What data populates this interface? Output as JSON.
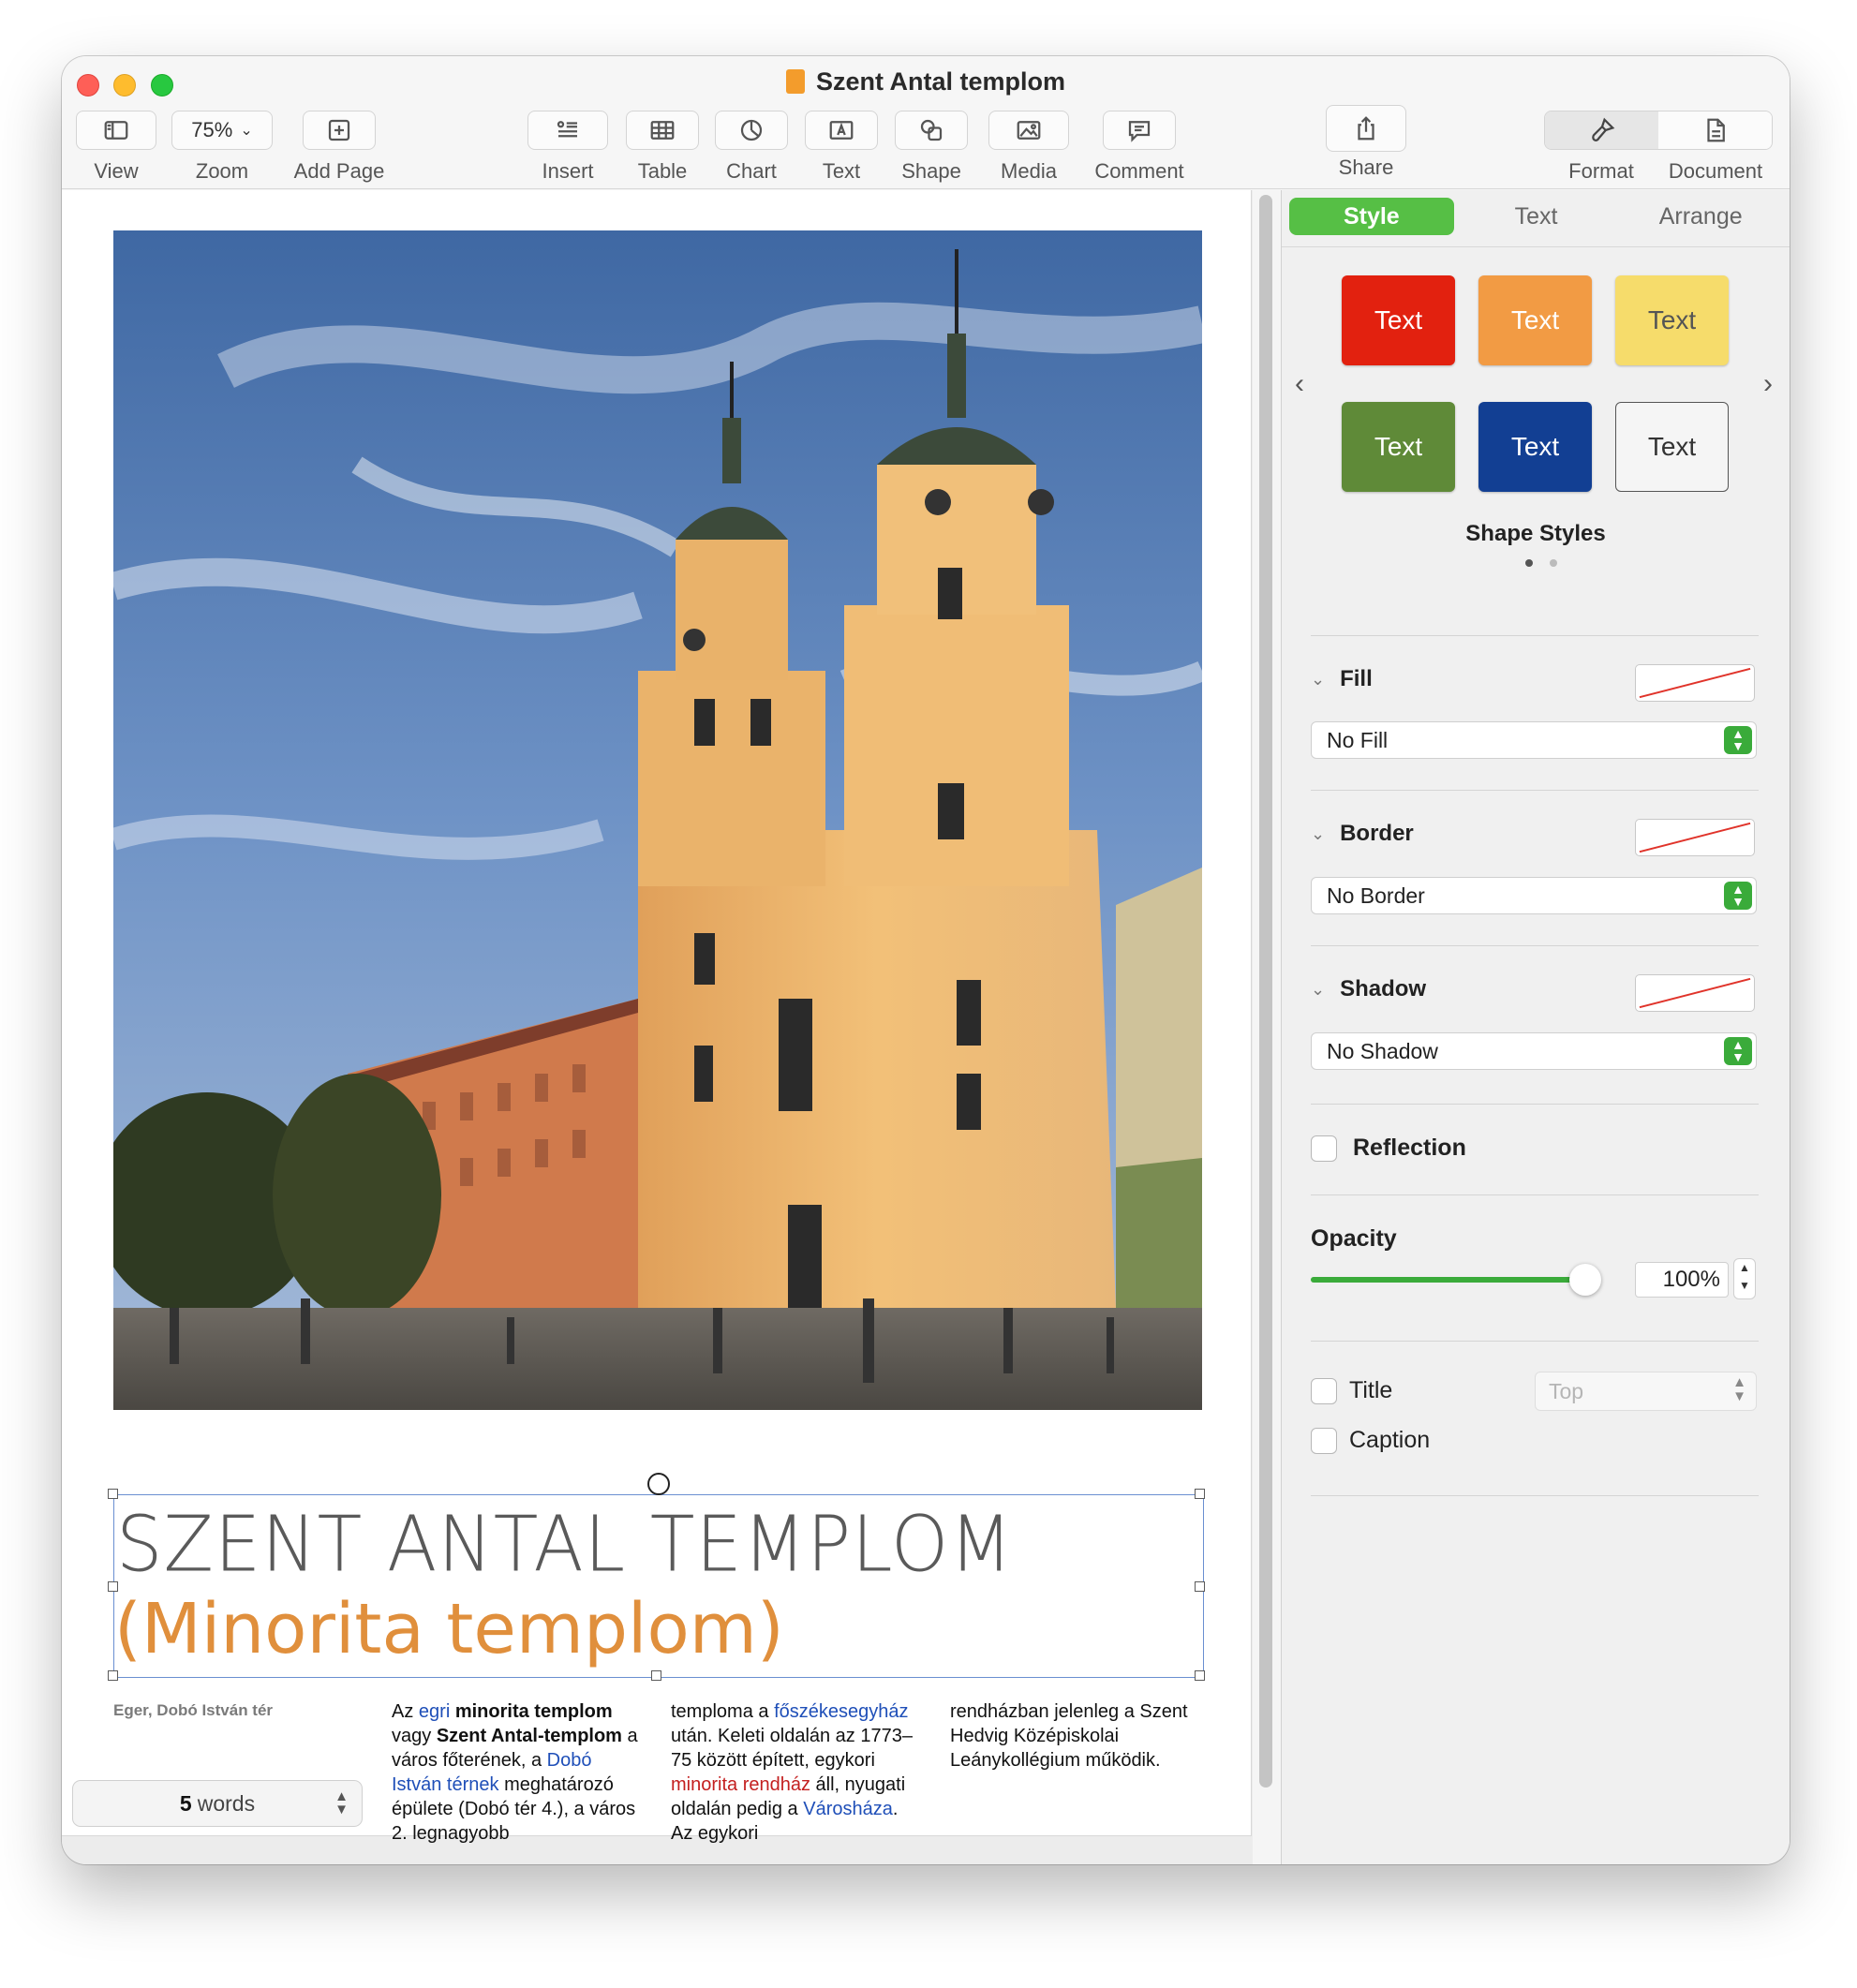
{
  "window": {
    "title": "Szent Antal templom"
  },
  "toolbar": {
    "view_label": "View",
    "zoom_value": "75%",
    "zoom_label": "Zoom",
    "add_page_label": "Add Page",
    "insert_label": "Insert",
    "table_label": "Table",
    "chart_label": "Chart",
    "text_label": "Text",
    "shape_label": "Shape",
    "media_label": "Media",
    "comment_label": "Comment",
    "share_label": "Share",
    "format_label": "Format",
    "document_label": "Document"
  },
  "document": {
    "title_line1": "SZENT ANTAL TEMPLOM",
    "title_line2": "(Minorita templom)",
    "image_caption": "Eger, Dobó István tér",
    "col1": {
      "t1": "Az ",
      "t2": "egri",
      "t3": " ",
      "t4": "minorita templom",
      "t5": " vagy ",
      "t6": "Szent Antal-templom",
      "t7": " a város főterének, a ",
      "t8": "Dobó István térnek",
      "t9": " meghatározó épülete (Dobó tér 4.), a város 2. legnagyobb"
    },
    "col2": {
      "t1": "temploma a ",
      "t2": "főszékesegyház",
      "t3": " után. Keleti oldalán az 1773–75 között épített, egykori ",
      "t4": "minorita rendház",
      "t5": " áll, nyugati oldalán pedig a ",
      "t6": "Városháza",
      "t7": ". Az egykori"
    },
    "col3": {
      "t1": "rendházban jelenleg a Szent Hedvig Középiskolai Leánykollégium működik."
    },
    "word_count": "5",
    "word_count_label": "words"
  },
  "inspector": {
    "tabs": [
      "Style",
      "Text",
      "Arrange"
    ],
    "style_buttons": [
      {
        "label": "Text",
        "bg": "#e2210f",
        "fg": "#ffffff"
      },
      {
        "label": "Text",
        "bg": "#f29b44",
        "fg": "#ffffff"
      },
      {
        "label": "Text",
        "bg": "#f6dc6b",
        "fg": "#555555"
      },
      {
        "label": "Text",
        "bg": "#5f8a38",
        "fg": "#ffffff"
      },
      {
        "label": "Text",
        "bg": "#123f93",
        "fg": "#ffffff"
      },
      {
        "label": "Text",
        "bg": "#f5f5f5",
        "fg": "#333333"
      }
    ],
    "shape_styles_label": "Shape Styles",
    "fill_label": "Fill",
    "fill_value": "No Fill",
    "border_label": "Border",
    "border_value": "No Border",
    "shadow_label": "Shadow",
    "shadow_value": "No Shadow",
    "reflection_label": "Reflection",
    "opacity_label": "Opacity",
    "opacity_value": "100%",
    "opacity_level": 1.0,
    "title_label": "Title",
    "title_position": "Top",
    "caption_label": "Caption"
  },
  "colors": {
    "accent_green": "#56bf45",
    "title_orange": "#e08f3c",
    "link_blue": "#1f4fb8",
    "link_red": "#c31f1f"
  }
}
